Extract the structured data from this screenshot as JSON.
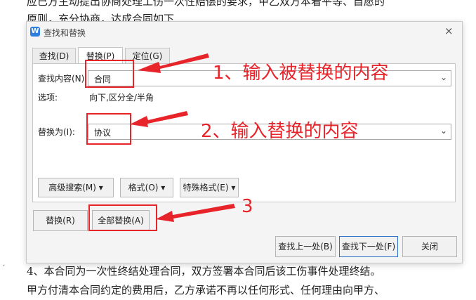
{
  "document": {
    "line_top1": "应已方主动提出协商处理工伤一次性赔偿的要求，甲乙双方本着平等、自愿的",
    "line_top2": "原则，充分协商，达成合同如下",
    "line_bottom1": "4、本合同为一次性终结处理合同，双方签署本合同后该工伤事件处理终结。",
    "line_bottom2": "甲方付清本合同约定的费用后，乙方承诺不再以任何形式、任何理由向甲方、",
    "cursor_glyph": "˅"
  },
  "dialog": {
    "app_icon_letter": "W",
    "title": "查找和替换",
    "close_glyph": "×",
    "tabs": [
      {
        "label": "查找(D)",
        "active": false
      },
      {
        "label": "替换(P)",
        "active": true
      },
      {
        "label": "定位(G)",
        "active": false
      }
    ],
    "find_label": "查找内容(N):",
    "find_value": "合同",
    "options_label": "选项:",
    "options_value": "向下,区分全/半角",
    "replace_label": "替换为(I):",
    "replace_value": "协议",
    "dropdown_arrow": "⌄",
    "advanced_search": "高级搜索(M) ▾",
    "format": "格式(O) ▾",
    "special_format": "特殊格式(E) ▾",
    "replace_button": "替换(R)",
    "replace_all_button": "全部替换(A)",
    "find_prev_button": "查找上一处(B)",
    "find_next_button": "查找下一处(F)",
    "close_button": "关闭"
  },
  "annotations": {
    "step1": "1、输入被替换的内容",
    "step2": "2、输入替换的内容",
    "step3": "3",
    "color": "#e8242b"
  },
  "icons": {
    "app": "wps-writer-icon",
    "close": "close-icon",
    "arrow": "red-arrow-icon"
  }
}
